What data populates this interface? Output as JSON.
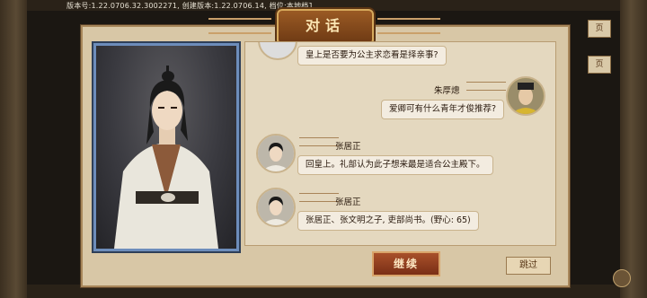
{
  "header": {
    "version_text": "版本号:1.22.0706.32.3002271, 创建版本:1.22.0706.14, 档位:本地档1"
  },
  "side_tabs": [
    "页",
    "页"
  ],
  "dialog": {
    "title": "对话",
    "messages": [
      {
        "speaker": "",
        "text": "皇上是否要为公主求恋看是择亲事?",
        "side": "left"
      },
      {
        "speaker": "朱厚熜",
        "text": "爱卿可有什么青年才俊推荐?",
        "side": "right"
      },
      {
        "speaker": "张居正",
        "text": "回皇上。礼部认为此子想来最是适合公主殿下。",
        "side": "left"
      },
      {
        "speaker": "张居正",
        "text": "张居正、张文明之子, 吏部尚书。(野心: 65)",
        "side": "left"
      }
    ],
    "continue_label": "继续",
    "skip_label": "跳过"
  },
  "colors": {
    "panel_bg": "#d8c7a6",
    "portrait_border": "#6d8dbb",
    "continue_bg": "#8a3a1c"
  }
}
